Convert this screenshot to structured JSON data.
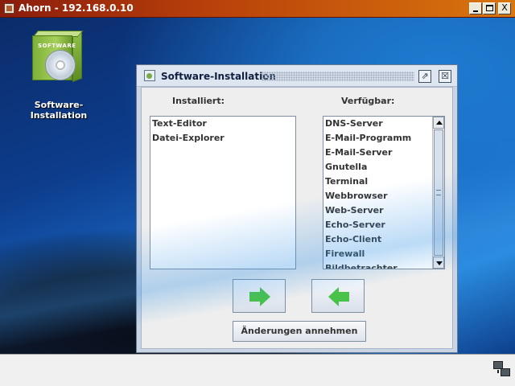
{
  "window": {
    "title": "Ahorn - 192.168.0.10",
    "min_symbol": "_",
    "max_symbol": "□",
    "close_symbol": "X"
  },
  "desktop": {
    "icon_label": "Software-Installation",
    "icon_box_text": "SOFTWARE"
  },
  "dialog": {
    "title": "Software-Installation",
    "popout_symbol": "⇗",
    "close_symbol": "☒",
    "installed_label": "Installiert:",
    "available_label": "Verfügbar:",
    "installed_items": [
      "Text-Editor",
      "Datei-Explorer"
    ],
    "available_items": [
      "DNS-Server",
      "E-Mail-Programm",
      "E-Mail-Server",
      "Gnutella",
      "Terminal",
      "Webbrowser",
      "Web-Server",
      "Echo-Server",
      "Echo-Client",
      "Firewall",
      "Bildbetrachter"
    ],
    "apply_button": "Änderungen annehmen"
  }
}
